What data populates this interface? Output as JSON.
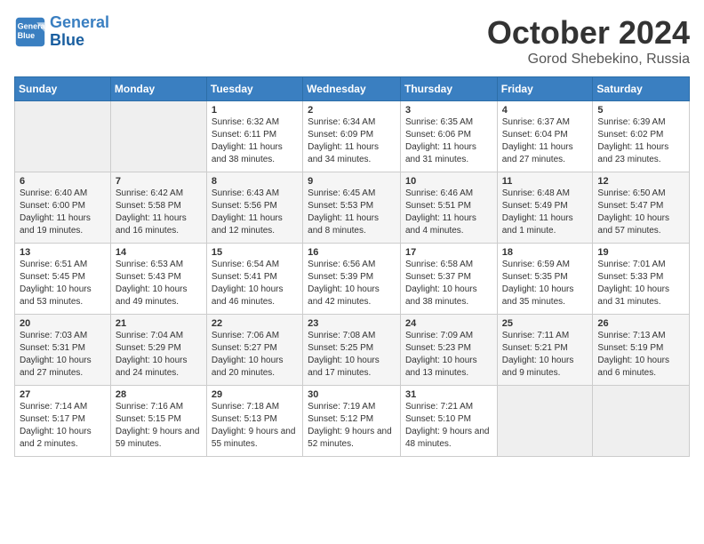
{
  "header": {
    "logo_line1": "General",
    "logo_line2": "Blue",
    "month": "October 2024",
    "location": "Gorod Shebekino, Russia"
  },
  "weekdays": [
    "Sunday",
    "Monday",
    "Tuesday",
    "Wednesday",
    "Thursday",
    "Friday",
    "Saturday"
  ],
  "weeks": [
    [
      {
        "day": "",
        "info": ""
      },
      {
        "day": "",
        "info": ""
      },
      {
        "day": "1",
        "info": "Sunrise: 6:32 AM\nSunset: 6:11 PM\nDaylight: 11 hours and 38 minutes."
      },
      {
        "day": "2",
        "info": "Sunrise: 6:34 AM\nSunset: 6:09 PM\nDaylight: 11 hours and 34 minutes."
      },
      {
        "day": "3",
        "info": "Sunrise: 6:35 AM\nSunset: 6:06 PM\nDaylight: 11 hours and 31 minutes."
      },
      {
        "day": "4",
        "info": "Sunrise: 6:37 AM\nSunset: 6:04 PM\nDaylight: 11 hours and 27 minutes."
      },
      {
        "day": "5",
        "info": "Sunrise: 6:39 AM\nSunset: 6:02 PM\nDaylight: 11 hours and 23 minutes."
      }
    ],
    [
      {
        "day": "6",
        "info": "Sunrise: 6:40 AM\nSunset: 6:00 PM\nDaylight: 11 hours and 19 minutes."
      },
      {
        "day": "7",
        "info": "Sunrise: 6:42 AM\nSunset: 5:58 PM\nDaylight: 11 hours and 16 minutes."
      },
      {
        "day": "8",
        "info": "Sunrise: 6:43 AM\nSunset: 5:56 PM\nDaylight: 11 hours and 12 minutes."
      },
      {
        "day": "9",
        "info": "Sunrise: 6:45 AM\nSunset: 5:53 PM\nDaylight: 11 hours and 8 minutes."
      },
      {
        "day": "10",
        "info": "Sunrise: 6:46 AM\nSunset: 5:51 PM\nDaylight: 11 hours and 4 minutes."
      },
      {
        "day": "11",
        "info": "Sunrise: 6:48 AM\nSunset: 5:49 PM\nDaylight: 11 hours and 1 minute."
      },
      {
        "day": "12",
        "info": "Sunrise: 6:50 AM\nSunset: 5:47 PM\nDaylight: 10 hours and 57 minutes."
      }
    ],
    [
      {
        "day": "13",
        "info": "Sunrise: 6:51 AM\nSunset: 5:45 PM\nDaylight: 10 hours and 53 minutes."
      },
      {
        "day": "14",
        "info": "Sunrise: 6:53 AM\nSunset: 5:43 PM\nDaylight: 10 hours and 49 minutes."
      },
      {
        "day": "15",
        "info": "Sunrise: 6:54 AM\nSunset: 5:41 PM\nDaylight: 10 hours and 46 minutes."
      },
      {
        "day": "16",
        "info": "Sunrise: 6:56 AM\nSunset: 5:39 PM\nDaylight: 10 hours and 42 minutes."
      },
      {
        "day": "17",
        "info": "Sunrise: 6:58 AM\nSunset: 5:37 PM\nDaylight: 10 hours and 38 minutes."
      },
      {
        "day": "18",
        "info": "Sunrise: 6:59 AM\nSunset: 5:35 PM\nDaylight: 10 hours and 35 minutes."
      },
      {
        "day": "19",
        "info": "Sunrise: 7:01 AM\nSunset: 5:33 PM\nDaylight: 10 hours and 31 minutes."
      }
    ],
    [
      {
        "day": "20",
        "info": "Sunrise: 7:03 AM\nSunset: 5:31 PM\nDaylight: 10 hours and 27 minutes."
      },
      {
        "day": "21",
        "info": "Sunrise: 7:04 AM\nSunset: 5:29 PM\nDaylight: 10 hours and 24 minutes."
      },
      {
        "day": "22",
        "info": "Sunrise: 7:06 AM\nSunset: 5:27 PM\nDaylight: 10 hours and 20 minutes."
      },
      {
        "day": "23",
        "info": "Sunrise: 7:08 AM\nSunset: 5:25 PM\nDaylight: 10 hours and 17 minutes."
      },
      {
        "day": "24",
        "info": "Sunrise: 7:09 AM\nSunset: 5:23 PM\nDaylight: 10 hours and 13 minutes."
      },
      {
        "day": "25",
        "info": "Sunrise: 7:11 AM\nSunset: 5:21 PM\nDaylight: 10 hours and 9 minutes."
      },
      {
        "day": "26",
        "info": "Sunrise: 7:13 AM\nSunset: 5:19 PM\nDaylight: 10 hours and 6 minutes."
      }
    ],
    [
      {
        "day": "27",
        "info": "Sunrise: 7:14 AM\nSunset: 5:17 PM\nDaylight: 10 hours and 2 minutes."
      },
      {
        "day": "28",
        "info": "Sunrise: 7:16 AM\nSunset: 5:15 PM\nDaylight: 9 hours and 59 minutes."
      },
      {
        "day": "29",
        "info": "Sunrise: 7:18 AM\nSunset: 5:13 PM\nDaylight: 9 hours and 55 minutes."
      },
      {
        "day": "30",
        "info": "Sunrise: 7:19 AM\nSunset: 5:12 PM\nDaylight: 9 hours and 52 minutes."
      },
      {
        "day": "31",
        "info": "Sunrise: 7:21 AM\nSunset: 5:10 PM\nDaylight: 9 hours and 48 minutes."
      },
      {
        "day": "",
        "info": ""
      },
      {
        "day": "",
        "info": ""
      }
    ]
  ]
}
